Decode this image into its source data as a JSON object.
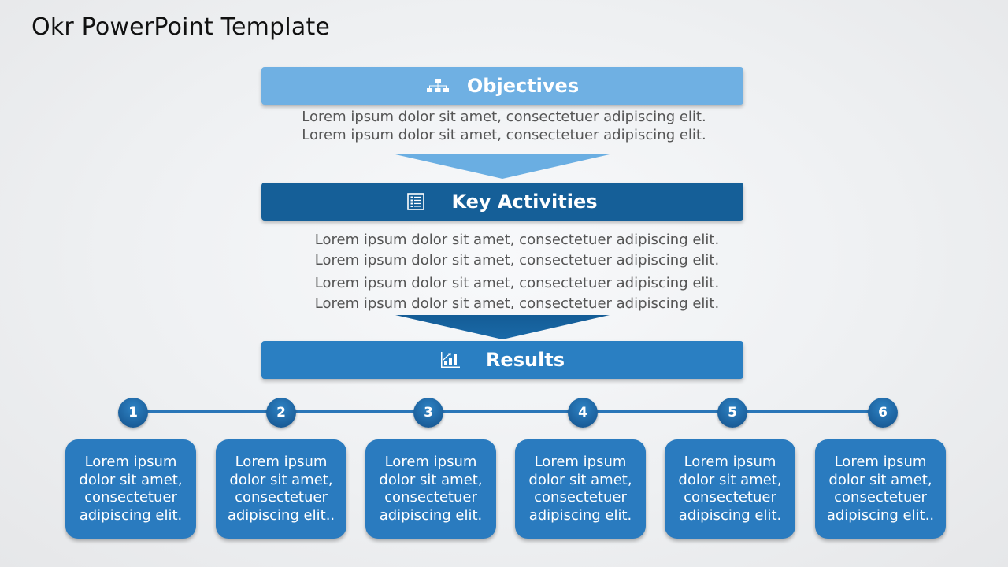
{
  "slide": {
    "title": "Okr PowerPoint Template"
  },
  "sections": {
    "objectives": {
      "label": "Objectives",
      "icon": "org-chart-icon",
      "color": "#6fb0e3",
      "lines": [
        "Lorem ipsum dolor sit amet, consectetuer adipiscing elit.",
        "Lorem ipsum dolor sit amet, consectetuer adipiscing elit."
      ]
    },
    "key_activities": {
      "label": "Key Activities",
      "icon": "list-icon",
      "color": "#155f98",
      "lines": [
        "Lorem ipsum dolor sit amet, consectetuer adipiscing elit.",
        "Lorem ipsum dolor sit amet, consectetuer adipiscing elit.",
        "Lorem ipsum dolor sit amet, consectetuer adipiscing elit.",
        "Lorem ipsum dolor sit amet, consectetuer adipiscing elit."
      ]
    },
    "results": {
      "label": "Results",
      "icon": "bar-chart-icon",
      "color": "#2a7fc2"
    }
  },
  "results_items": [
    {
      "number": "1",
      "text": "Lorem ipsum dolor sit amet, consectetuer adipiscing elit."
    },
    {
      "number": "2",
      "text": "Lorem ipsum dolor sit amet, consectetuer adipiscing elit.."
    },
    {
      "number": "3",
      "text": "Lorem ipsum dolor sit amet, consectetuer adipiscing elit."
    },
    {
      "number": "4",
      "text": "Lorem ipsum dolor sit amet, consectetuer adipiscing elit."
    },
    {
      "number": "5",
      "text": "Lorem ipsum dolor sit amet, consectetuer adipiscing elit."
    },
    {
      "number": "6",
      "text": "Lorem ipsum dolor sit amet, consectetuer adipiscing elit.."
    }
  ]
}
